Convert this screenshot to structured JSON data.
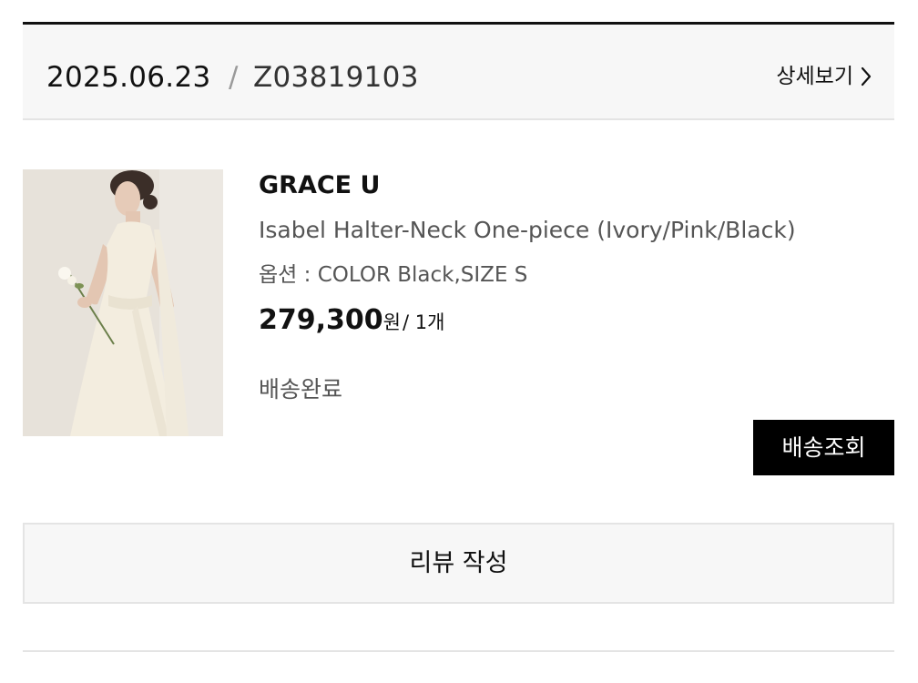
{
  "order": {
    "date": "2025.06.23",
    "separator": "/",
    "number": "Z03819103",
    "detail_label": "상세보기"
  },
  "item": {
    "brand": "GRACE U",
    "name": "Isabel Halter-Neck One-piece (Ivory/Pink/Black)",
    "option": "옵션 : COLOR Black,SIZE S",
    "price": "279,300",
    "price_unit": "원",
    "quantity": "/ 1개",
    "status": "배송완료",
    "image_icon": "product-photo-dress"
  },
  "actions": {
    "track_label": "배송조회",
    "review_label": "리뷰 작성"
  },
  "colors": {
    "accent": "#000000",
    "header_bg": "#f7f7f7",
    "border": "#e4e4e4",
    "muted_text": "#555555"
  }
}
